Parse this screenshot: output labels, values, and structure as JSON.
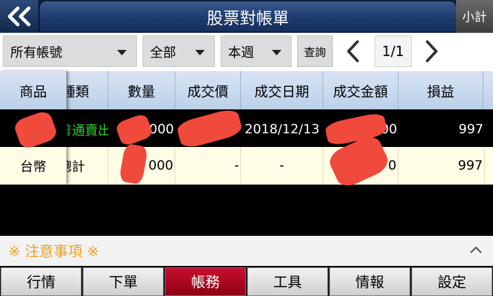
{
  "header": {
    "title": "股票對帳單",
    "subtotal_label": "小計"
  },
  "toolbar": {
    "account_select": "所有帳號",
    "type_select": "全部",
    "period_select": "本週",
    "query_label": "查詢",
    "page_indicator": "1/1"
  },
  "table": {
    "headers": [
      "商品",
      "種類",
      "數量",
      "成交價",
      "成交日期",
      "成交金額",
      "損益"
    ],
    "rows": [
      {
        "product": "",
        "kind": "普通賣出",
        "qty": "000",
        "price": "",
        "date": "2018/12/13",
        "amount": "00",
        "pnl": "997"
      },
      {
        "product": "台幣",
        "kind": "總計",
        "qty": "000",
        "price": "-",
        "date": "-",
        "amount": "0",
        "pnl": "997"
      }
    ],
    "colors": {
      "sell": "#2fd12f",
      "header_bg": "#c9d8ee",
      "total_bg": "#fffde6"
    }
  },
  "notice": {
    "title": "※ 注意事項 ※"
  },
  "bottom_nav": [
    {
      "label": "行情"
    },
    {
      "label": "下單"
    },
    {
      "label": "帳務",
      "active": true
    },
    {
      "label": "工具"
    },
    {
      "label": "情報"
    },
    {
      "label": "設定"
    }
  ],
  "colors": {
    "accent_red": "#c8102e",
    "notice_orange": "#f0a020",
    "redaction": "#f04a3c"
  }
}
